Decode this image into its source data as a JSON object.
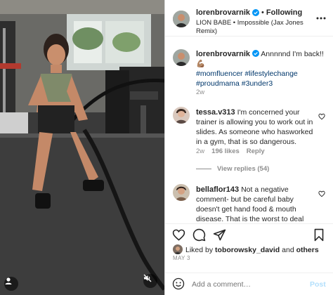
{
  "post": {
    "username": "lorenbrovarnik",
    "separator": "•",
    "follow_label": "Following",
    "audio": "LION BABE • Impossible (Jax Jones Remix)"
  },
  "caption": {
    "username": "lorenbrovarnik",
    "text": "Annnnnd I'm back!!",
    "emoji": "💪🏽",
    "hashtags": "#momfluencer #lifestylechange #proudmama #3under3",
    "time": "2w"
  },
  "comments": [
    {
      "username": "tessa.v313",
      "text": "I'm concerned your trainer is allowing you to work out in slides. As someone who hasworked in a gym, that is so dangerous.",
      "time": "2w",
      "likes": "196 likes",
      "reply": "Reply",
      "view_replies": "View replies (54)"
    },
    {
      "username": "bellaflor143",
      "text": "Not a negative comment- but be careful baby doesn't get hand food & mouth disease. That is the worst to deal"
    }
  ],
  "likes": {
    "prefix": "Liked by",
    "user": "toborowsky_david",
    "and": "and",
    "others": "others"
  },
  "date": "MAY 3",
  "add_comment": {
    "placeholder": "Add a comment…",
    "post_label": "Post"
  },
  "colors": {
    "verified": "#0095f6",
    "link": "#00376b",
    "post_disabled": "#b2dffc"
  }
}
